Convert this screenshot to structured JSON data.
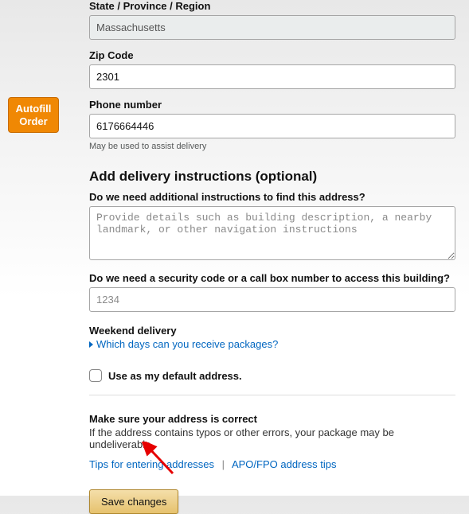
{
  "autofill": {
    "line1": "Autofill",
    "line2": "Order"
  },
  "fields": {
    "state": {
      "label": "State / Province / Region",
      "value": "Massachusetts"
    },
    "zip": {
      "label": "Zip Code",
      "value": "2301"
    },
    "phone": {
      "label": "Phone number",
      "value": "6176664446",
      "hint": "May be used to assist delivery"
    }
  },
  "instructions": {
    "heading": "Add delivery instructions (optional)",
    "q1_label": "Do we need additional instructions to find this address?",
    "q1_placeholder": "Provide details such as building description, a nearby landmark, or other navigation instructions",
    "q2_label": "Do we need a security code or a call box number to access this building?",
    "q2_placeholder": "1234"
  },
  "weekend": {
    "label": "Weekend delivery",
    "link": "Which days can you receive packages?"
  },
  "default_address": {
    "label": "Use as my default address."
  },
  "correct": {
    "heading": "Make sure your address is correct",
    "text": "If the address contains typos or other errors, your package may be undeliverable.",
    "link1": "Tips for entering addresses",
    "sep": "|",
    "link2": "APO/FPO address tips"
  },
  "save_label": "Save changes"
}
